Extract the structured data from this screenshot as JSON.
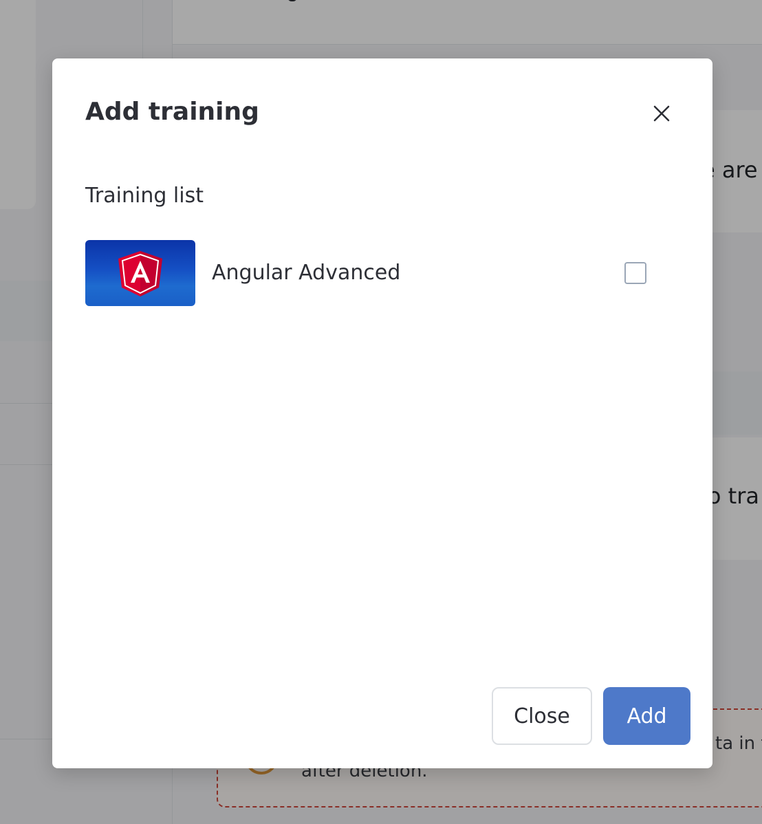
{
  "background": {
    "right_text_1": "e are",
    "right_text_2": "lo tra",
    "warning_text_line1": "ta in fu",
    "warning_text_line2": "after deletion."
  },
  "modal": {
    "title": "Add training",
    "section_label": "Training list",
    "trainings": [
      {
        "name": "Angular Advanced",
        "icon": "angular-logo",
        "checked": false
      }
    ],
    "buttons": {
      "close_label": "Close",
      "add_label": "Add"
    }
  },
  "colors": {
    "primary": "#4e79c9",
    "angular_red": "#dd0031",
    "thumb_blue": "#1550c4"
  }
}
